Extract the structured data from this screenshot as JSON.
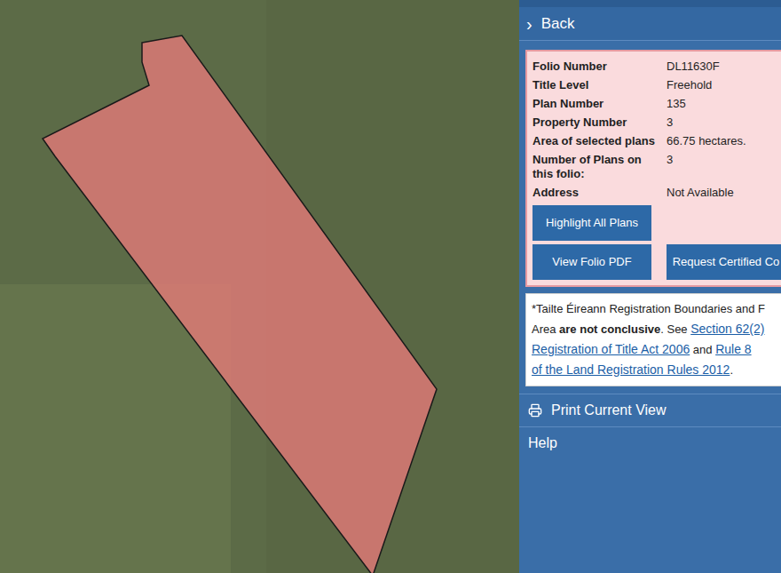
{
  "back": {
    "icon": "›",
    "label": "Back"
  },
  "folio": {
    "rows": [
      {
        "label": "Folio Number",
        "value": "DL11630F"
      },
      {
        "label": "Title Level",
        "value": "Freehold"
      },
      {
        "label": "Plan Number",
        "value": "135"
      },
      {
        "label": "Property Number",
        "value": "3"
      },
      {
        "label": "Area of selected plans",
        "value": "66.75 hectares."
      },
      {
        "label": "Number of Plans on this folio:",
        "value": "3"
      },
      {
        "label": "Address",
        "value": "Not Available"
      }
    ],
    "button_rows": [
      [
        "Highlight All Plans"
      ],
      [
        "View Folio PDF",
        "Request Certified Co"
      ]
    ]
  },
  "notice": {
    "lines": [
      [
        {
          "text": "*Tailte Éireann Registration Boundaries and F",
          "kind": "plain"
        }
      ],
      [
        {
          "text": "Area ",
          "kind": "plain"
        },
        {
          "text": "are not conclusive",
          "kind": "bold"
        },
        {
          "text": ". See ",
          "kind": "plain"
        },
        {
          "text": "Section 62(2)",
          "kind": "link"
        }
      ],
      [
        {
          "text": "Registration of Title Act 2006",
          "kind": "link"
        },
        {
          "text": " and ",
          "kind": "plain"
        },
        {
          "text": "Rule 8",
          "kind": "link"
        }
      ],
      [
        {
          "text": "of the Land Registration Rules 2012",
          "kind": "link"
        },
        {
          "text": ".",
          "kind": "plain"
        }
      ]
    ]
  },
  "menu": [
    {
      "label": "Print Current View",
      "kind": "print"
    },
    {
      "label": "Help",
      "kind": "plain"
    }
  ]
}
